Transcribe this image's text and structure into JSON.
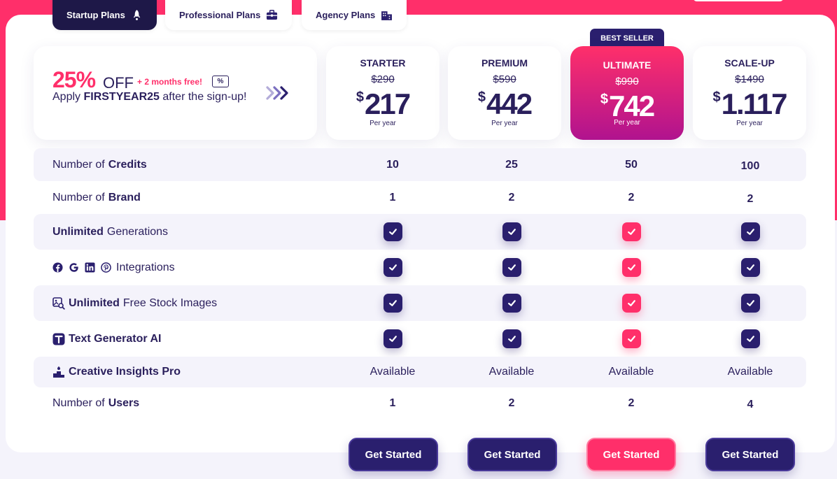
{
  "tabs": [
    {
      "label": "Startup Plans",
      "icon": "rocket-icon",
      "active": true
    },
    {
      "label": "Professional Plans",
      "icon": "briefcase-icon",
      "active": false
    },
    {
      "label": "Agency Plans",
      "icon": "building-icon",
      "active": false
    }
  ],
  "promo": {
    "discount": "25%",
    "off": "OFF",
    "bonus": "+ 2 months free!",
    "coupon_symbol": "%",
    "apply_prefix": "Apply ",
    "code": "FIRSTYEAR25",
    "apply_suffix": " after the sign-up!"
  },
  "badge": "BEST SELLER",
  "plans": [
    {
      "name": "STARTER",
      "old_price": "$290",
      "currency": "$",
      "price": "217",
      "period": "Per year"
    },
    {
      "name": "PREMIUM",
      "old_price": "$590",
      "currency": "$",
      "price": "442",
      "period": "Per year"
    },
    {
      "name": "ULTIMATE",
      "old_price": "$990",
      "currency": "$",
      "price": "742",
      "period": "Per year"
    },
    {
      "name": "SCALE-UP",
      "old_price": "$1490",
      "currency": "$",
      "price": "1.117",
      "period": "Per year"
    }
  ],
  "features": {
    "credits": {
      "pre": "Number of ",
      "bold": "Credits",
      "values": [
        "10",
        "25",
        "50",
        "100"
      ]
    },
    "brand": {
      "pre": "Number of ",
      "bold": "Brand",
      "values": [
        "1",
        "2",
        "2",
        "2"
      ]
    },
    "generations": {
      "bold": "Unlimited",
      "post": " Generations"
    },
    "integrations": {
      "post": "Integrations"
    },
    "stock": {
      "bold": "Unlimited",
      "post": " Free Stock Images"
    },
    "textgen": {
      "bold": "Text Generator AI"
    },
    "insights": {
      "bold": "Creative Insights Pro",
      "values": [
        "Available",
        "Available",
        "Available",
        "Available"
      ]
    },
    "users": {
      "pre": "Number of ",
      "bold": "Users",
      "values": [
        "1",
        "2",
        "2",
        "4"
      ]
    }
  },
  "cta": "Get Started",
  "colors": {
    "accent": "#ff2f6a",
    "primary": "#2a1f6e",
    "text": "#2a1f5c"
  }
}
